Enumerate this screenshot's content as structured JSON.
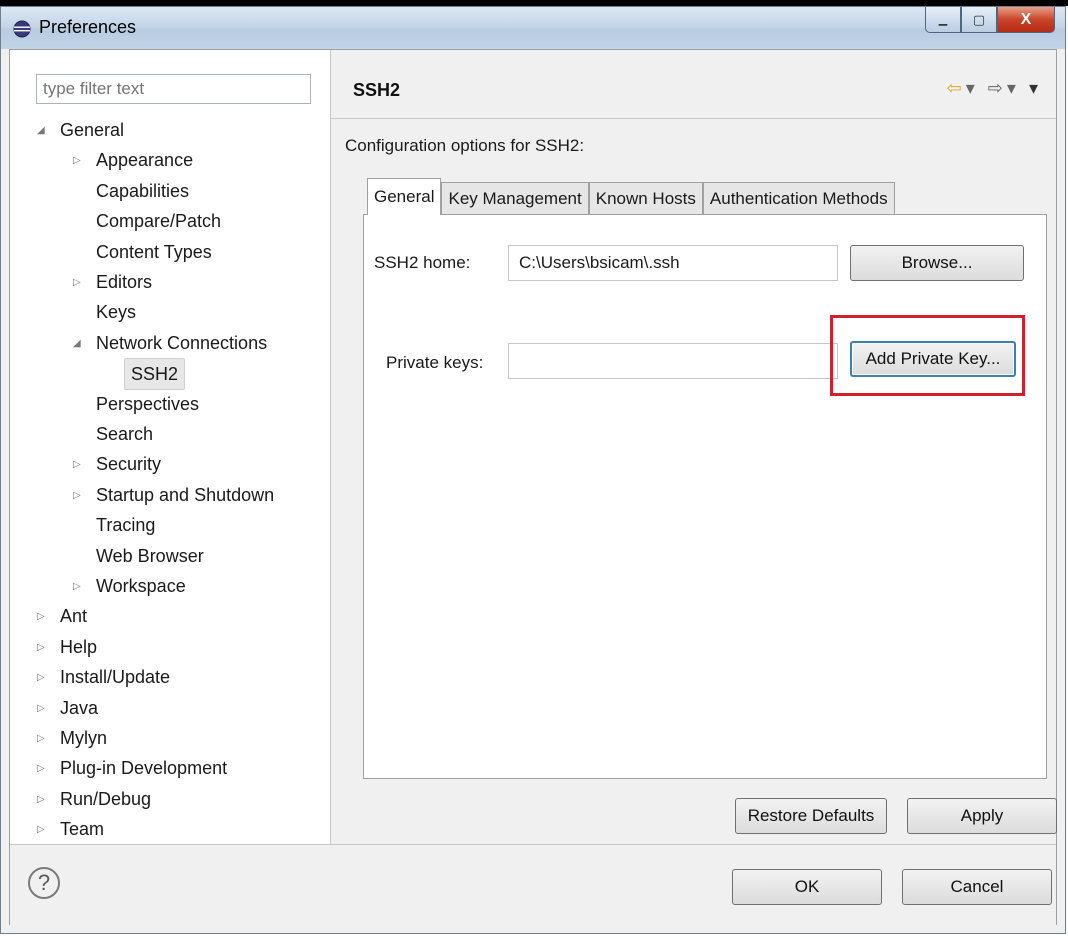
{
  "window": {
    "title": "Preferences",
    "controls": {
      "minimize": "▁",
      "maximize": "▢",
      "close": "X"
    }
  },
  "filter": {
    "placeholder": "type filter text"
  },
  "tree": [
    {
      "label": "General",
      "twisty": "expanded"
    },
    {
      "label": "Appearance",
      "twisty": "collapsed"
    },
    {
      "label": "Capabilities",
      "twisty": "none"
    },
    {
      "label": "Compare/Patch",
      "twisty": "none"
    },
    {
      "label": "Content Types",
      "twisty": "none"
    },
    {
      "label": "Editors",
      "twisty": "collapsed"
    },
    {
      "label": "Keys",
      "twisty": "none"
    },
    {
      "label": "Network Connections",
      "twisty": "expanded"
    },
    {
      "label": "SSH2",
      "twisty": "none",
      "selected": true
    },
    {
      "label": "Perspectives",
      "twisty": "none"
    },
    {
      "label": "Search",
      "twisty": "none"
    },
    {
      "label": "Security",
      "twisty": "collapsed"
    },
    {
      "label": "Startup and Shutdown",
      "twisty": "collapsed"
    },
    {
      "label": "Tracing",
      "twisty": "none"
    },
    {
      "label": "Web Browser",
      "twisty": "none"
    },
    {
      "label": "Workspace",
      "twisty": "collapsed"
    },
    {
      "label": "Ant",
      "twisty": "collapsed"
    },
    {
      "label": "Help",
      "twisty": "collapsed"
    },
    {
      "label": "Install/Update",
      "twisty": "collapsed"
    },
    {
      "label": "Java",
      "twisty": "collapsed"
    },
    {
      "label": "Mylyn",
      "twisty": "collapsed"
    },
    {
      "label": "Plug-in Development",
      "twisty": "collapsed"
    },
    {
      "label": "Run/Debug",
      "twisty": "collapsed"
    },
    {
      "label": "Team",
      "twisty": "collapsed"
    }
  ],
  "page": {
    "title": "SSH2",
    "description": "Configuration options for SSH2:",
    "nav": {
      "back": "⇦",
      "back_menu": "▾",
      "forward": "⇨",
      "forward_menu": "▾",
      "view_menu": "▾"
    }
  },
  "tabs": [
    "General",
    "Key Management",
    "Known Hosts",
    "Authentication Methods"
  ],
  "general": {
    "ssh2_home_label": "SSH2 home:",
    "ssh2_home_value": "C:\\Users\\bsicam\\.ssh",
    "browse_label": "Browse...",
    "private_keys_label": "Private keys:",
    "private_keys_value": "",
    "add_private_key_label": "Add Private Key..."
  },
  "page_buttons": {
    "restore_defaults": "Restore Defaults",
    "apply": "Apply"
  },
  "footer": {
    "help_icon": "?",
    "ok": "OK",
    "cancel": "Cancel"
  },
  "colors": {
    "highlight_box": "#d0202b",
    "title_gradient_top": "#dbe7f4",
    "close_button": "#c9452a"
  }
}
